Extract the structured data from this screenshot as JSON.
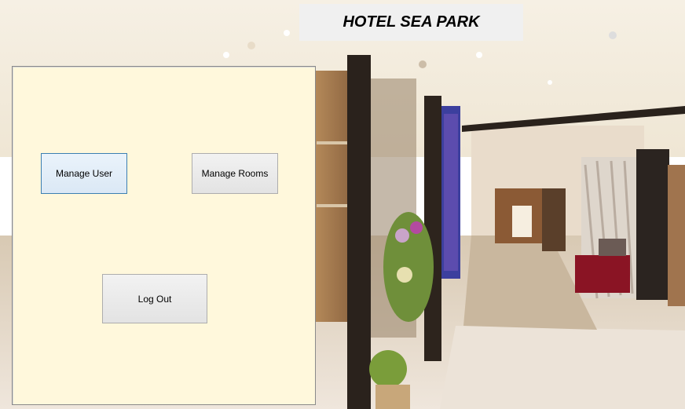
{
  "window": {
    "title": "HOTEL SEA PARK"
  },
  "menu": {
    "manage_user_label": "Manage User",
    "manage_rooms_label": "Manage Rooms",
    "logout_label": "Log Out"
  },
  "colors": {
    "panel_background": "#fff8dc",
    "banner_background": "#f0f0f0",
    "button_face": "#e5e5e5",
    "focused_border": "#3c7fb1"
  }
}
